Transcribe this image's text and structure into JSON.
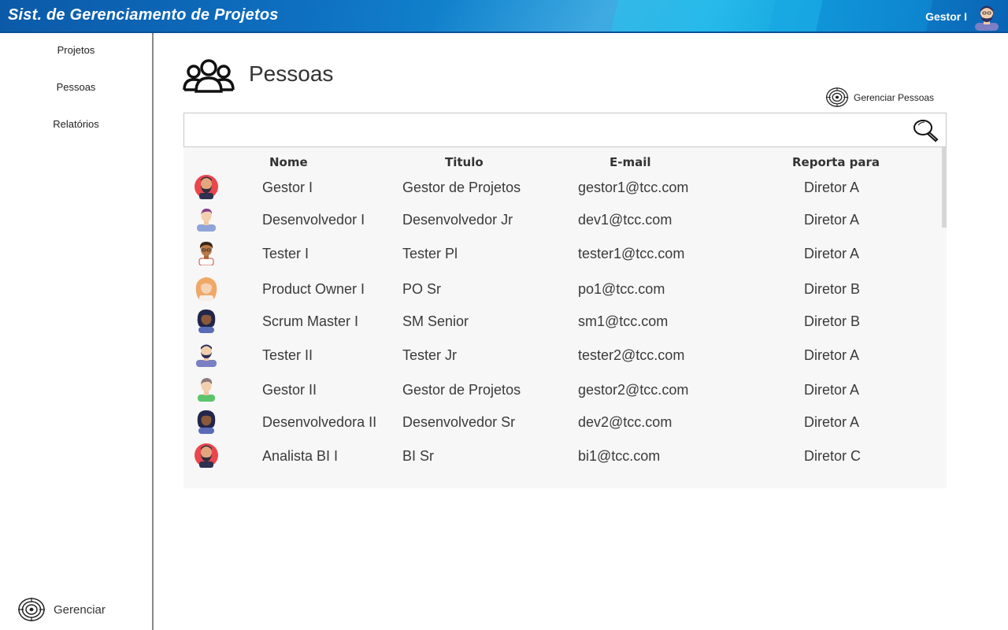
{
  "header": {
    "app_title": "Sist. de Gerenciamento de Projetos",
    "user_name": "Gestor I",
    "colors": {
      "bar": "#0e6fc0",
      "accent": "#16a9e3"
    }
  },
  "sidebar": {
    "items": [
      {
        "label": "Projetos"
      },
      {
        "label": "Pessoas"
      },
      {
        "label": "Relatórios"
      }
    ],
    "bottom": {
      "label": "Gerenciar",
      "icon": "target-icon"
    }
  },
  "main": {
    "title": "Pessoas",
    "title_icon": "people-group-icon",
    "manage_link": {
      "label": "Gerenciar Pessoas",
      "icon": "target-icon"
    },
    "search": {
      "value": "",
      "placeholder": "",
      "icon": "search-icon"
    },
    "table": {
      "columns": [
        "Nome",
        "Titulo",
        "E-mail",
        "Reporta para"
      ],
      "rows": [
        {
          "avatar": "avatar-bearded-man-red",
          "nome": "Gestor I",
          "titulo": "Gestor de Projetos",
          "email": "gestor1@tcc.com",
          "reporta": "Diretor A"
        },
        {
          "avatar": "avatar-man-purple-hair",
          "nome": "Desenvolvedor I",
          "titulo": "Desenvolvedor Jr",
          "email": "dev1@tcc.com",
          "reporta": "Diretor A"
        },
        {
          "avatar": "avatar-curly-hair-man",
          "nome": "Tester I",
          "titulo": "Tester Pl",
          "email": "tester1@tcc.com",
          "reporta": "Diretor A"
        },
        {
          "avatar": "avatar-blonde-woman",
          "nome": "Product Owner I",
          "titulo": "PO Sr",
          "email": "po1@tcc.com",
          "reporta": "Diretor B"
        },
        {
          "avatar": "avatar-curly-woman",
          "nome": "Scrum Master I",
          "titulo": "SM Senior",
          "email": "sm1@tcc.com",
          "reporta": "Diretor B"
        },
        {
          "avatar": "avatar-bearded-man-blue",
          "nome": "Tester II",
          "titulo": "Tester Jr",
          "email": "tester2@tcc.com",
          "reporta": "Diretor A"
        },
        {
          "avatar": "avatar-man-green-shirt",
          "nome": "Gestor II",
          "titulo": "Gestor de Projetos",
          "email": "gestor2@tcc.com",
          "reporta": "Diretor A"
        },
        {
          "avatar": "avatar-curly-woman",
          "nome": "Desenvolvedora II",
          "titulo": "Desenvolvedor Sr",
          "email": "dev2@tcc.com",
          "reporta": "Diretor A"
        },
        {
          "avatar": "avatar-bearded-man-red",
          "nome": "Analista BI I",
          "titulo": "BI Sr",
          "email": "bi1@tcc.com",
          "reporta": "Diretor C"
        }
      ]
    }
  }
}
